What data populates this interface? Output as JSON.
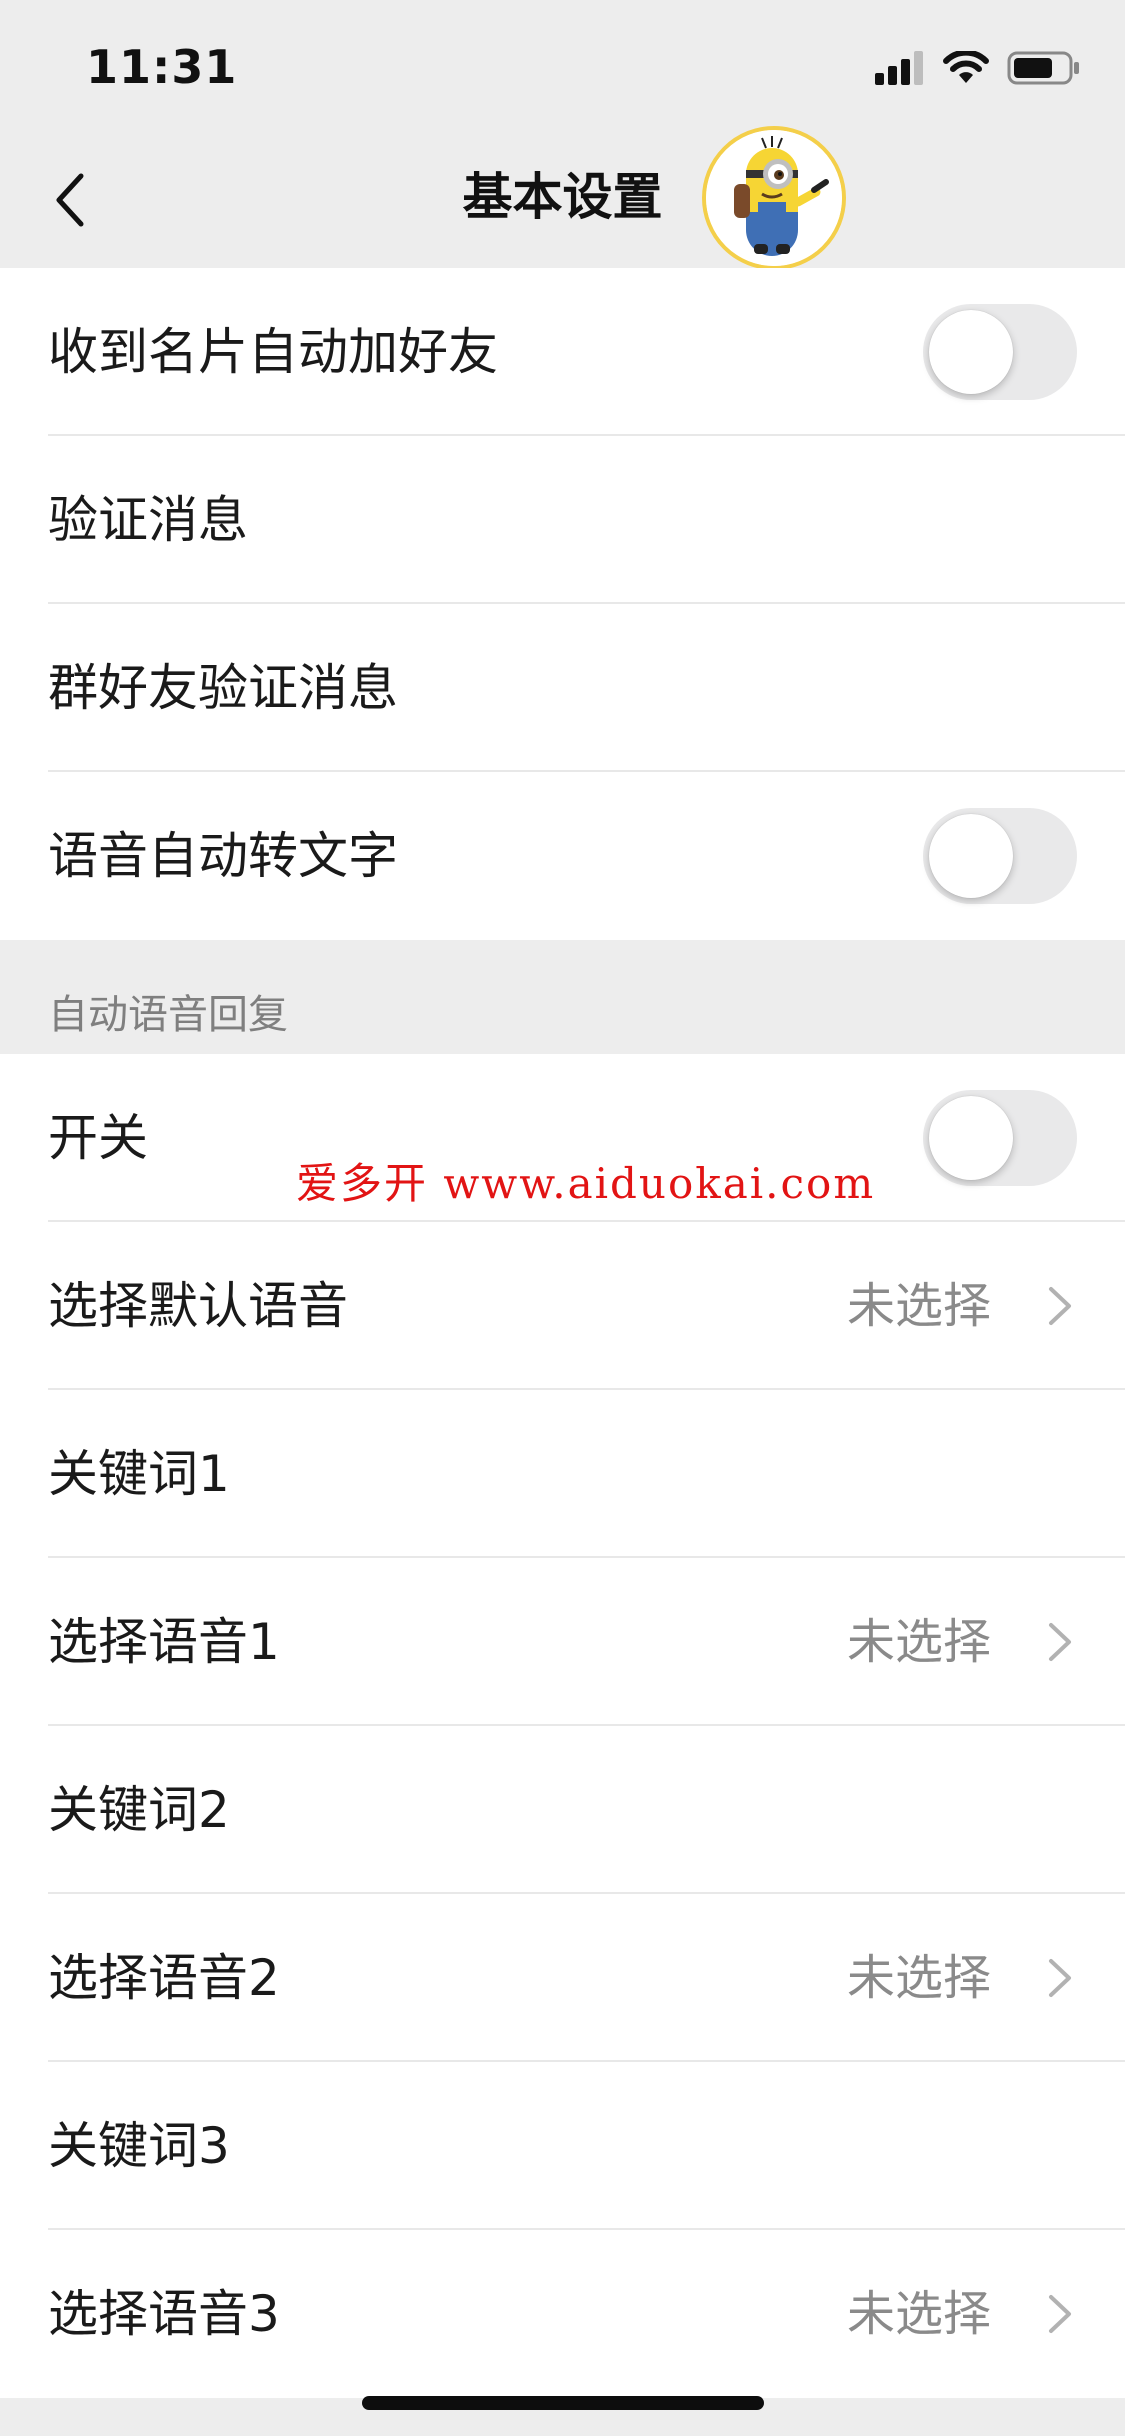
{
  "status_bar": {
    "time": "11:31",
    "icons": [
      "signal-icon",
      "wifi-icon",
      "battery-icon"
    ]
  },
  "nav": {
    "title": "基本设置",
    "back_icon": "chevron-left-icon"
  },
  "group_basic": {
    "items": [
      {
        "label": "收到名片自动加好友",
        "type": "toggle",
        "on": false
      },
      {
        "label": "验证消息",
        "type": "plain"
      },
      {
        "label": "群好友验证消息",
        "type": "plain"
      },
      {
        "label": "语音自动转文字",
        "type": "toggle",
        "on": false
      }
    ]
  },
  "group_voice_reply": {
    "header": "自动语音回复",
    "items": [
      {
        "label": "开关",
        "type": "toggle",
        "on": false
      },
      {
        "label": "选择默认语音",
        "type": "select",
        "value": "未选择"
      },
      {
        "label": "关键词1",
        "type": "plain"
      },
      {
        "label": "选择语音1",
        "type": "select",
        "value": "未选择"
      },
      {
        "label": "关键词2",
        "type": "plain"
      },
      {
        "label": "选择语音2",
        "type": "select",
        "value": "未选择"
      },
      {
        "label": "关键词3",
        "type": "plain"
      },
      {
        "label": "选择语音3",
        "type": "select",
        "value": "未选择"
      }
    ]
  },
  "watermark": "爱多开 www.aiduokai.com",
  "colors": {
    "background": "#ededed",
    "toggle_off": "#e9e9ea",
    "watermark": "#e21414",
    "avatar_border": "#f4cf4a"
  }
}
